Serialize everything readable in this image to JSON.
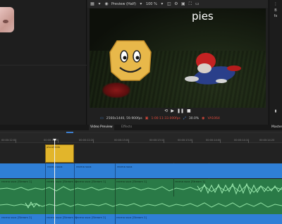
{
  "monitor": {
    "toolbar": {
      "preview_label": "Preview (Half)",
      "zoom": "100 %"
    },
    "video_title": "pies",
    "status": {
      "resolution": "2560x1440, 59.900fps",
      "timecode": "1:00:11:33.000fps",
      "zoom_percent": "30.0%",
      "audio": "VA1064"
    }
  },
  "tabs": {
    "video_preview": "Video Preview",
    "effects": "Effects",
    "master": "Master"
  },
  "timeline": {
    "ruler_labels": [
      "00:00:12:00",
      "00:00:12:10",
      "00:00:12:20",
      "00:00:13:00",
      "00:00:13:10",
      "00:00:13:20",
      "00:00:14:00",
      "00:00:14:10",
      "00:00:14:20"
    ],
    "gold_clip_label": "pisca/texto",
    "video_clips": [
      "recma ssca",
      "recma ssca",
      "recma ssca",
      "recma ssca"
    ],
    "audio_clips_top": [
      "recma ssca [Stream 1]",
      "recma ssca [Stream 1]",
      "recma ssca [Stream 1]",
      "recma ssca [Stream 1]",
      "recma ssca [Stream 1]"
    ],
    "audio_clips_bottom": [
      "recma ssca [Stream 2]",
      "recma ssca [Stream 2]",
      "recma ssca [Stream 2]",
      "recma ssca [Stream 2]"
    ]
  },
  "colors": {
    "video_track": "#2f7fd6",
    "audio_track": "#2a7a47",
    "gold_clip": "#e2b52b",
    "accent_red": "#e04a3c"
  }
}
